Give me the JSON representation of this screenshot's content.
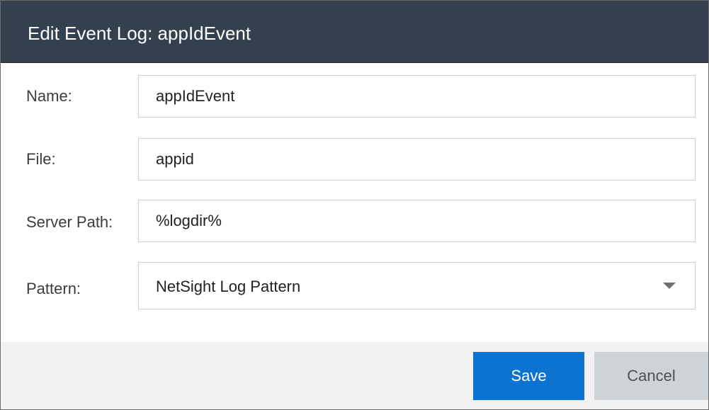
{
  "dialog": {
    "title": "Edit Event Log: appIdEvent"
  },
  "form": {
    "name": {
      "label": "Name:",
      "value": "appIdEvent"
    },
    "file": {
      "label": "File:",
      "value": "appid"
    },
    "server_path": {
      "label": "Server Path:",
      "value": "%logdir%"
    },
    "pattern": {
      "label": "Pattern:",
      "value": "NetSight Log Pattern",
      "icon": "chevron-down-icon"
    }
  },
  "footer": {
    "save_label": "Save",
    "cancel_label": "Cancel"
  },
  "colors": {
    "titlebar": "#35404f",
    "primary_button": "#0c73d1",
    "secondary_button": "#ced3d8",
    "footer": "#f2f2f2"
  }
}
